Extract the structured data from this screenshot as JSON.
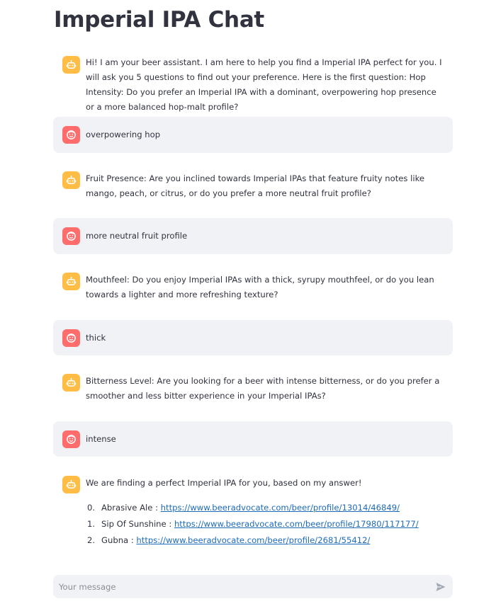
{
  "title": "Imperial IPA Chat",
  "messages": [
    {
      "role": "assistant",
      "text": "Hi! I am your beer assistant. I am here to help you find a Imperial IPA perfect for you. I will ask you 5 questions to find out your preference. Here is the first question: Hop Intensity: Do you prefer an Imperial IPA with a dominant, overpowering hop presence or a more balanced hop-malt profile?"
    },
    {
      "role": "user",
      "text": "overpowering hop"
    },
    {
      "role": "assistant",
      "text": "Fruit Presence: Are you inclined towards Imperial IPAs that feature fruity notes like mango, peach, or citrus, or do you prefer a more neutral fruit profile?"
    },
    {
      "role": "user",
      "text": "more neutral fruit profile"
    },
    {
      "role": "assistant",
      "text": "Mouthfeel: Do you enjoy Imperial IPAs with a thick, syrupy mouthfeel, or do you lean towards a lighter and more refreshing texture?"
    },
    {
      "role": "user",
      "text": "thick"
    },
    {
      "role": "assistant",
      "text": "Bitterness Level: Are you looking for a beer with intense bitterness, or do you prefer a smoother and less bitter experience in your Imperial IPAs?"
    },
    {
      "role": "user",
      "text": "intense"
    },
    {
      "role": "assistant",
      "text": "We are finding a perfect Imperial IPA for you, based on my answer!"
    }
  ],
  "recommendations": [
    {
      "num": "0.",
      "name": "Abrasive Ale : ",
      "url": "https://www.beeradvocate.com/beer/profile/13014/46849/"
    },
    {
      "num": "1.",
      "name": "Sip Of Sunshine : ",
      "url": "https://www.beeradvocate.com/beer/profile/17980/117177/"
    },
    {
      "num": "2.",
      "name": "Gubna : ",
      "url": "https://www.beeradvocate.com/beer/profile/2681/55412/"
    }
  ],
  "input": {
    "placeholder": "Your message",
    "value": ""
  },
  "icons": {
    "assistant": "robot-icon",
    "user": "smiley-face-icon",
    "send": "send-arrow-icon"
  },
  "colors": {
    "assistant_avatar": "#ffbd45",
    "user_avatar": "#ff6c6c",
    "user_bubble": "#f0f2f6",
    "link": "#1e6bb8"
  }
}
